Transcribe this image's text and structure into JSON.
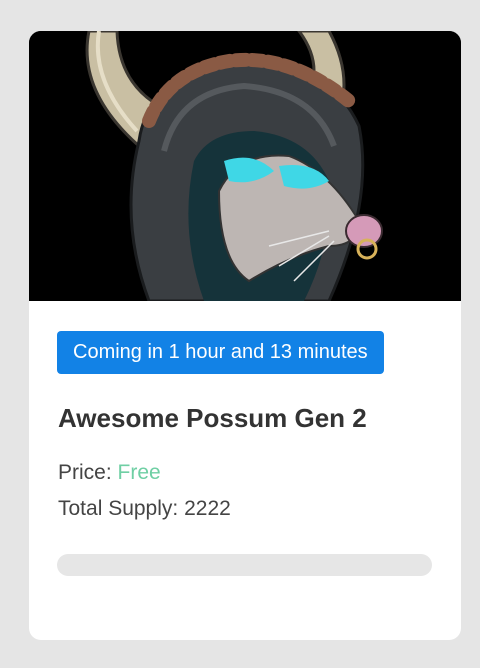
{
  "nft": {
    "image_alt": "Hooded possum with horned helmet",
    "countdown_label": "Coming in 1 hour and 13 minutes",
    "title": "Awesome Possum Gen 2",
    "price_label": "Price:",
    "price_value": "Free",
    "supply_label": "Total Supply:",
    "supply_value": "2222",
    "mint_progress": 0
  },
  "colors": {
    "accent": "#1282e6",
    "free": "#6fcfa4",
    "background": "#e5e5e5",
    "card": "#ffffff"
  }
}
